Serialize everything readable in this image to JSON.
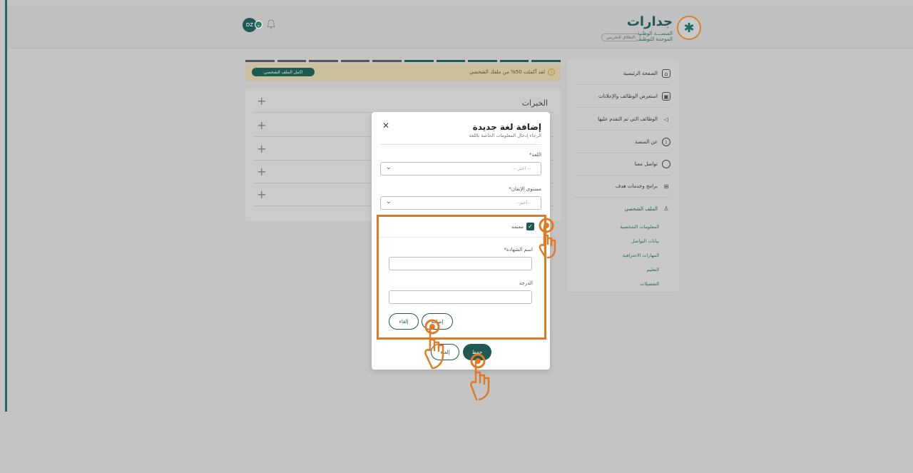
{
  "brand": {
    "name": "جدارات",
    "subtitle_line1": "المنصـــة الوطنية",
    "subtitle_line2": "الموحدة للتوظيف",
    "pill": "الإطلاق التجريبي"
  },
  "header": {
    "avatar_initials": "DZ"
  },
  "profile_progress": {
    "text": "لقد أكملت 50% من ملفك الشخصي",
    "complete_button": "اكمل الملف الشخصي",
    "segments_total": 10,
    "segments_done": 5
  },
  "content": {
    "section_title": "الخبرات",
    "rows_count": 5
  },
  "sidebar": {
    "items": [
      {
        "label": "الصفحة الرئيسية",
        "icon": "home-icon"
      },
      {
        "label": "استعرض الوظائف والإعلانات",
        "icon": "briefcase-icon"
      },
      {
        "label": "الوظائف التي تم التقدم عليها",
        "icon": "send-icon"
      },
      {
        "label": "عن المنصة",
        "icon": "info-icon"
      },
      {
        "label": "تواصل معنا",
        "icon": "chat-icon"
      },
      {
        "label": "برامج وخدمات هدف",
        "icon": "grid-icon"
      },
      {
        "label": "الملف الشخصي",
        "icon": "user-icon"
      }
    ],
    "sub_items": [
      "المعلومات الشخصية",
      "بيانات التواصل",
      "المهارات الاحترافية",
      "التعليم",
      "التفضيلات"
    ]
  },
  "modal": {
    "title": "إضافة لغة جديدة",
    "subtitle": "الرجاء إدخال المعلومات الخاصة باللغة",
    "language_label": "اللغة*",
    "language_placeholder": "-- اختر --",
    "level_label": "مستوى الإتقان*",
    "level_placeholder": "--اختر--",
    "certified_label": "معتمد",
    "certified_checked": true,
    "certificate_name_label": "اسم الشهادة*",
    "grade_label": "الدرجة",
    "inner_add_button": "إضافة",
    "inner_cancel_button": "إلغاء",
    "cancel_button": "إلغاء",
    "save_button": "حفظ"
  },
  "colors": {
    "primary": "#1f5a52",
    "highlight": "#e07b24",
    "banner": "#cbbf9e"
  }
}
